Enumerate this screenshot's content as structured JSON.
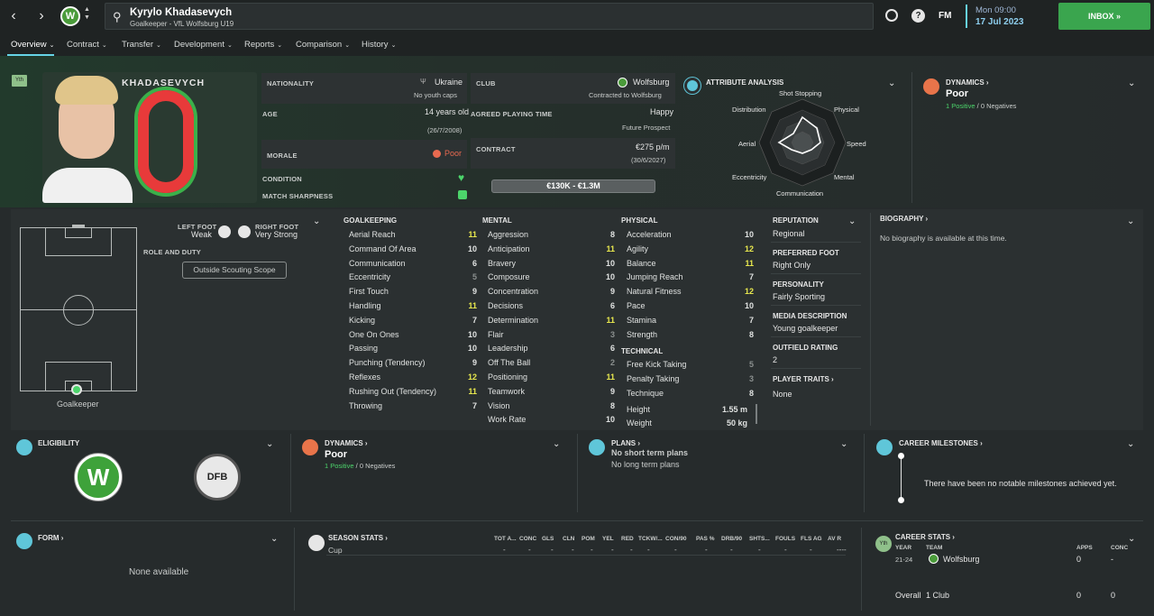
{
  "header": {
    "player_name": "Kyrylo Khadasevych",
    "player_sub": "Goalkeeper - VfL Wolfsburg U19",
    "time": "Mon 09:00",
    "date": "17 Jul 2023",
    "fm_label": "FM",
    "inbox_label": "INBOX"
  },
  "tabs": [
    {
      "label": "Overview"
    },
    {
      "label": "Contract"
    },
    {
      "label": "Transfer"
    },
    {
      "label": "Development"
    },
    {
      "label": "Reports"
    },
    {
      "label": "Comparison"
    },
    {
      "label": "History"
    }
  ],
  "hero": {
    "badge": "Yth",
    "shirt_name": "KHADASEVYCH",
    "shirt_number": "0",
    "nationality_label": "NATIONALITY",
    "nationality": "Ukraine",
    "youth_caps": "No youth caps",
    "age_label": "AGE",
    "age": "14 years old",
    "dob": "(26/7/2008)",
    "morale_label": "MORALE",
    "morale": "Poor",
    "condition_label": "CONDITION",
    "sharpness_label": "MATCH SHARPNESS",
    "club_label": "CLUB",
    "club": "Wolfsburg",
    "contracted": "Contracted to Wolfsburg",
    "playing_time_label": "AGREED PLAYING TIME",
    "playing_time": "Happy",
    "playing_time_sub": "Future Prospect",
    "contract_label": "CONTRACT",
    "wage": "€275 p/m",
    "contract_end": "(30/6/2027)",
    "value": "€130K - €1.3M"
  },
  "attribute_analysis": {
    "title": "ATTRIBUTE ANALYSIS",
    "labels": [
      "Shot Stopping",
      "Physical",
      "Speed",
      "Mental",
      "Communication",
      "Eccentricity",
      "Aerial",
      "Distribution"
    ]
  },
  "dynamics_top": {
    "title": "DYNAMICS",
    "value": "Poor",
    "positives": "1 Positive",
    "sep": "/",
    "negatives": "0 Negatives"
  },
  "position": {
    "left_foot_label": "LEFT FOOT",
    "left_foot": "Weak",
    "right_foot_label": "RIGHT FOOT",
    "right_foot": "Very Strong",
    "role_label": "ROLE AND DUTY",
    "role_button": "Outside Scouting Scope",
    "position_name": "Goalkeeper"
  },
  "goalkeeping": {
    "title": "GOALKEEPING",
    "items": [
      {
        "name": "Aerial Reach",
        "value": "11"
      },
      {
        "name": "Command Of Area",
        "value": "10"
      },
      {
        "name": "Communication",
        "value": "6"
      },
      {
        "name": "Eccentricity",
        "value": "5"
      },
      {
        "name": "First Touch",
        "value": "9"
      },
      {
        "name": "Handling",
        "value": "11"
      },
      {
        "name": "Kicking",
        "value": "7"
      },
      {
        "name": "One On Ones",
        "value": "10"
      },
      {
        "name": "Passing",
        "value": "10"
      },
      {
        "name": "Punching (Tendency)",
        "value": "9"
      },
      {
        "name": "Reflexes",
        "value": "12"
      },
      {
        "name": "Rushing Out (Tendency)",
        "value": "11"
      },
      {
        "name": "Throwing",
        "value": "7"
      }
    ]
  },
  "mental": {
    "title": "MENTAL",
    "items": [
      {
        "name": "Aggression",
        "value": "8"
      },
      {
        "name": "Anticipation",
        "value": "11"
      },
      {
        "name": "Bravery",
        "value": "10"
      },
      {
        "name": "Composure",
        "value": "10"
      },
      {
        "name": "Concentration",
        "value": "9"
      },
      {
        "name": "Decisions",
        "value": "6"
      },
      {
        "name": "Determination",
        "value": "11"
      },
      {
        "name": "Flair",
        "value": "3"
      },
      {
        "name": "Leadership",
        "value": "6"
      },
      {
        "name": "Off The Ball",
        "value": "2"
      },
      {
        "name": "Positioning",
        "value": "11"
      },
      {
        "name": "Teamwork",
        "value": "9"
      },
      {
        "name": "Vision",
        "value": "8"
      },
      {
        "name": "Work Rate",
        "value": "10"
      }
    ]
  },
  "physical": {
    "title": "PHYSICAL",
    "items": [
      {
        "name": "Acceleration",
        "value": "10"
      },
      {
        "name": "Agility",
        "value": "12"
      },
      {
        "name": "Balance",
        "value": "11"
      },
      {
        "name": "Jumping Reach",
        "value": "7"
      },
      {
        "name": "Natural Fitness",
        "value": "12"
      },
      {
        "name": "Pace",
        "value": "10"
      },
      {
        "name": "Stamina",
        "value": "7"
      },
      {
        "name": "Strength",
        "value": "8"
      }
    ]
  },
  "technical": {
    "title": "TECHNICAL",
    "items": [
      {
        "name": "Free Kick Taking",
        "value": "5"
      },
      {
        "name": "Penalty Taking",
        "value": "3"
      },
      {
        "name": "Technique",
        "value": "8"
      }
    ]
  },
  "physique": {
    "height_label": "Height",
    "height": "1.55 m",
    "weight_label": "Weight",
    "weight": "50 kg"
  },
  "info": {
    "reputation_label": "REPUTATION",
    "reputation": "Regional",
    "preferred_foot_label": "PREFERRED FOOT",
    "preferred_foot": "Right Only",
    "personality_label": "PERSONALITY",
    "personality": "Fairly Sporting",
    "media_label": "MEDIA DESCRIPTION",
    "media": "Young goalkeeper",
    "outfield_label": "OUTFIELD RATING",
    "outfield": "2",
    "traits_label": "PLAYER TRAITS",
    "traits": "None"
  },
  "biography": {
    "title": "BIOGRAPHY",
    "text": "No biography is available at this time."
  },
  "eligibility": {
    "title": "ELIGIBILITY"
  },
  "dynamics_bottom": {
    "title": "DYNAMICS",
    "value": "Poor",
    "positives": "1 Positive",
    "sep": "/",
    "negatives": "0 Negatives"
  },
  "plans": {
    "title": "PLANS",
    "short": "No short term plans",
    "long": "No long term plans"
  },
  "milestones": {
    "title": "CAREER MILESTONES",
    "text": "There have been no notable milestones achieved yet."
  },
  "form": {
    "title": "FORM",
    "text": "None available"
  },
  "season_stats": {
    "title": "SEASON STATS",
    "headers": [
      "TOT A...",
      "CONC",
      "GLS",
      "CLN",
      "POM",
      "YEL",
      "RED",
      "TCKW/...",
      "CON/90",
      "PAS %",
      "DRB/90",
      "SHTS...",
      "FOULS",
      "FLS AG",
      "AV R"
    ],
    "row_label": "Cup",
    "row_values": [
      "-",
      "-",
      "-",
      "-",
      "-",
      "-",
      "-",
      "-",
      "-",
      "-",
      "-",
      "-",
      "-",
      "-",
      "----"
    ]
  },
  "career_stats": {
    "title": "CAREER STATS",
    "badge": "Yth",
    "year_label": "YEAR",
    "team_label": "TEAM",
    "apps_label": "APPS",
    "conc_label": "CONC",
    "year": "21-24",
    "team": "Wolfsburg",
    "apps": "0",
    "conc": "-",
    "overall_label": "Overall",
    "overall_clubs": "1 Club",
    "overall_apps": "0",
    "overall_conc": "0"
  },
  "colors": {
    "accent_cyan": "#6dd8ea",
    "positive_green": "#4cd46b",
    "highlight_yellow": "#e8e84e",
    "inbox_green": "#3aa54e",
    "morale_red": "#e86a50",
    "dynamics_orange": "#e8744a"
  }
}
